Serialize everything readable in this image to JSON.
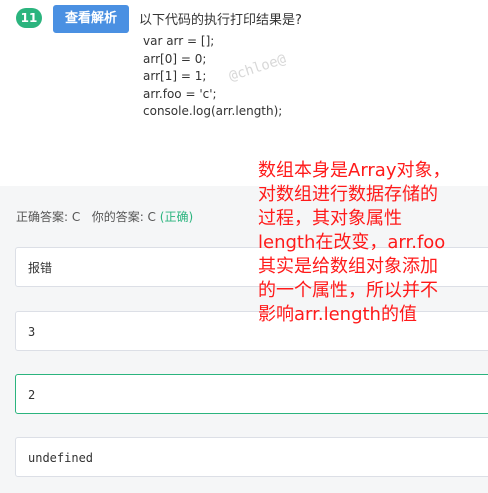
{
  "question": {
    "number": "11",
    "view_analysis_label": "查看解析",
    "prompt": "以下代码的执行打印结果是?",
    "code_lines": [
      "var arr = [];",
      "arr[0] = 0;",
      "arr[1] = 1;",
      "arr.foo = 'c';",
      "console.log(arr.length);"
    ],
    "watermark": "@chloe@"
  },
  "answer": {
    "correct_label": "正确答案: C",
    "your_label": "你的答案: C",
    "status": "(正确)"
  },
  "options": [
    {
      "text": "报错",
      "selected": false
    },
    {
      "text": "3",
      "selected": false
    },
    {
      "text": "2",
      "selected": true
    },
    {
      "text": "undefined",
      "selected": false
    }
  ],
  "annotation_lines": [
    "数组本身是Array对象，",
    "对数组进行数据存储的",
    "过程，其对象属性",
    "length在改变，arr.foo",
    "其实是给数组对象添加",
    "的一个属性，所以并不",
    "影响arr.length的值"
  ],
  "colors": {
    "badge": "#2bb47e",
    "button": "#4a90e2",
    "correct": "#2bb47e",
    "annotation": "#ff1a1a"
  }
}
